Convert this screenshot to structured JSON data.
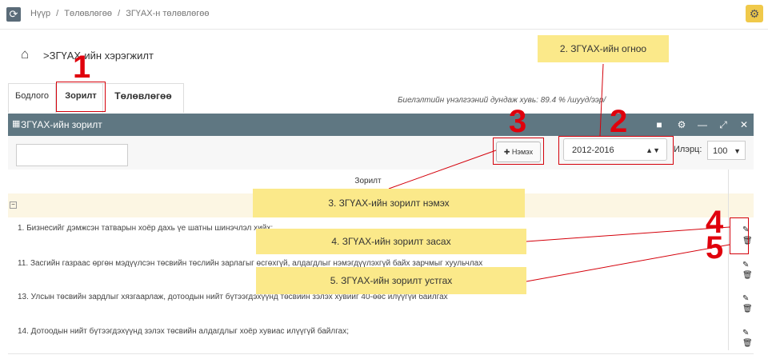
{
  "breadcrumb": [
    "Нүүр",
    "/",
    "Төлөвлөгөө",
    "/",
    "ЗГҮАХ-н төлөвлөгөө"
  ],
  "page_title": ">ЗГҮАХ-ийн хэрэгжилт",
  "tabs": [
    {
      "label": "Бодлого"
    },
    {
      "label": "Зорилт"
    },
    {
      "label": "Төлөвлөгөө"
    }
  ],
  "summary": "Биелэлтийн үнэлгээний дундаж хувь: 89.4 % /шууд/ээр/",
  "panel": {
    "title": "ЗГҮАХ-ийн зорилт"
  },
  "toolbar": {
    "search_value": "",
    "add_label": "Нэмэх",
    "year_value": "2012-2016",
    "limit_label": "Илэрц:",
    "limit_value": "100"
  },
  "table": {
    "column_header": "Зорилт",
    "rows": [
      "1. Бизнесийг дэмжсэн татварын хоёр дахь үе шатны шинэчлэл хийх;",
      "11. Засгийн газраас өргөн мэдүүлсэн төсвийн төслийн зарлагыг өсгөхгүй, алдагдлыг нэмэгдүүлэхгүй байх зарчмыг хуульчлах",
      "13. Улсын төсвийн зардлыг хязгаарлаж, дотоодын нийт бүтээгдэхүүнд төсвийн зэлэх хувийг 40-өөс илүүгүй байлгах",
      "14. Дотоодын нийт бүтээгдэхүүнд зэлэх төсвийн алдагдлыг хоёр хувиас илүүгүй байлгах;"
    ]
  },
  "callouts": {
    "year": "2. ЗГҮАХ-ийн огноо",
    "add": "3. ЗГҮАХ-ийн зорилт нэмэх",
    "edit": "4. ЗГҮАХ-ийн зорилт засах",
    "delete": "5. ЗГҮАХ-ийн зорилт устгах"
  },
  "step_numbers": [
    "1",
    "2",
    "3",
    "4",
    "5"
  ],
  "colors": {
    "panel_header": "#5f7782",
    "callout": "#fbe98a",
    "marker": "#e0000c",
    "group_row": "#fcf6e3"
  }
}
